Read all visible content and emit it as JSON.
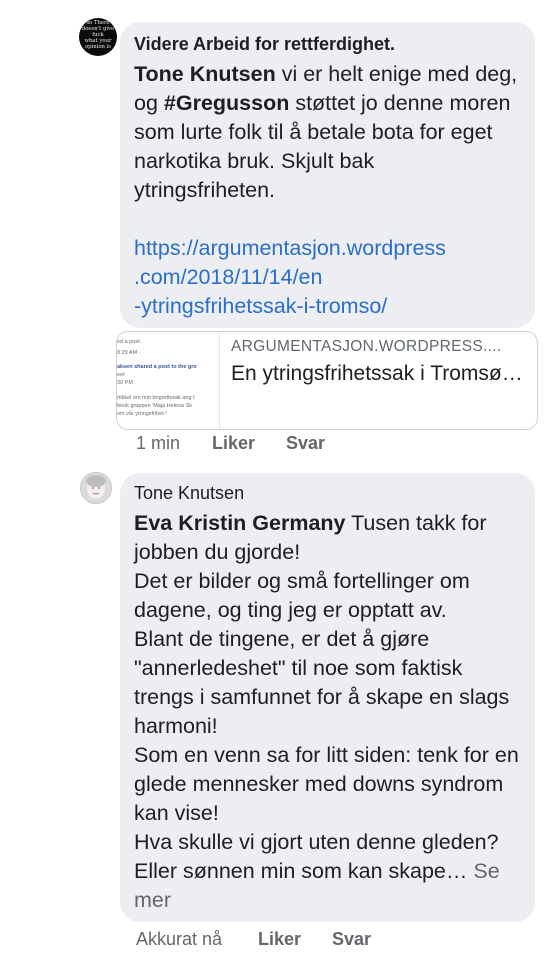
{
  "comment1": {
    "author": "Videre Arbeid for rettferdighet.",
    "avatar_text": [
      "so There",
      "doesn't give",
      "fuck",
      "what your",
      "opinion is"
    ],
    "mention": "Tone Knutsen",
    "text_a": " vi er helt enige med deg, og ",
    "hashtag": "#Gregusson",
    "text_b": " støttet jo denne moren som lurte folk til å betale bota for eget narkotika bruk. Skjult bak ytringsfriheten.",
    "link_lines": [
      "https://argumentasjon.wordpress",
      ".com/2018/11/14/en",
      "-ytringsfrihetssak-i-tromso/"
    ],
    "preview": {
      "domain": "ARGUMENTASJON.WORDPRESS....",
      "title": "En ytringsfrihetssak i Tromsø…",
      "thumb_lines": [
        "ed a post.",
        "8:29 AM · ",
        "aksen shared a post to the gro",
        "eet",
        "30 PM",
        "rtikkel om min bngrettssak ang t",
        "book gruppen 'Maja Helena Sk",
        "om vår ytringsfrihet !"
      ]
    },
    "actions": {
      "time": "1 min",
      "like": "Liker",
      "reply": "Svar"
    }
  },
  "comment2": {
    "author": "Tone Knutsen",
    "mention": "Eva Kristin Germany",
    "text_1": " Tusen takk for jobben du gjorde!",
    "text_2": "Det er bilder og små fortellinger om dagene, og ting jeg er opptatt av.",
    "text_3": "Blant de tingene, er det å gjøre \"annerledeshet\" til noe som faktisk trengs i samfunnet for å skape en slags harmoni!",
    "text_4": "Som en venn sa for litt siden: tenk for en glede mennesker med downs syndrom kan vise!",
    "text_5": "Hva skulle vi gjort uten denne gleden? Eller sønnen min som kan skape… ",
    "see_more": "Se mer",
    "actions": {
      "time": "Akkurat nå",
      "like": "Liker",
      "reply": "Svar"
    }
  },
  "colors": {
    "bubble": "#eceef1",
    "link": "#2a6ec9",
    "meta": "#65676b"
  }
}
